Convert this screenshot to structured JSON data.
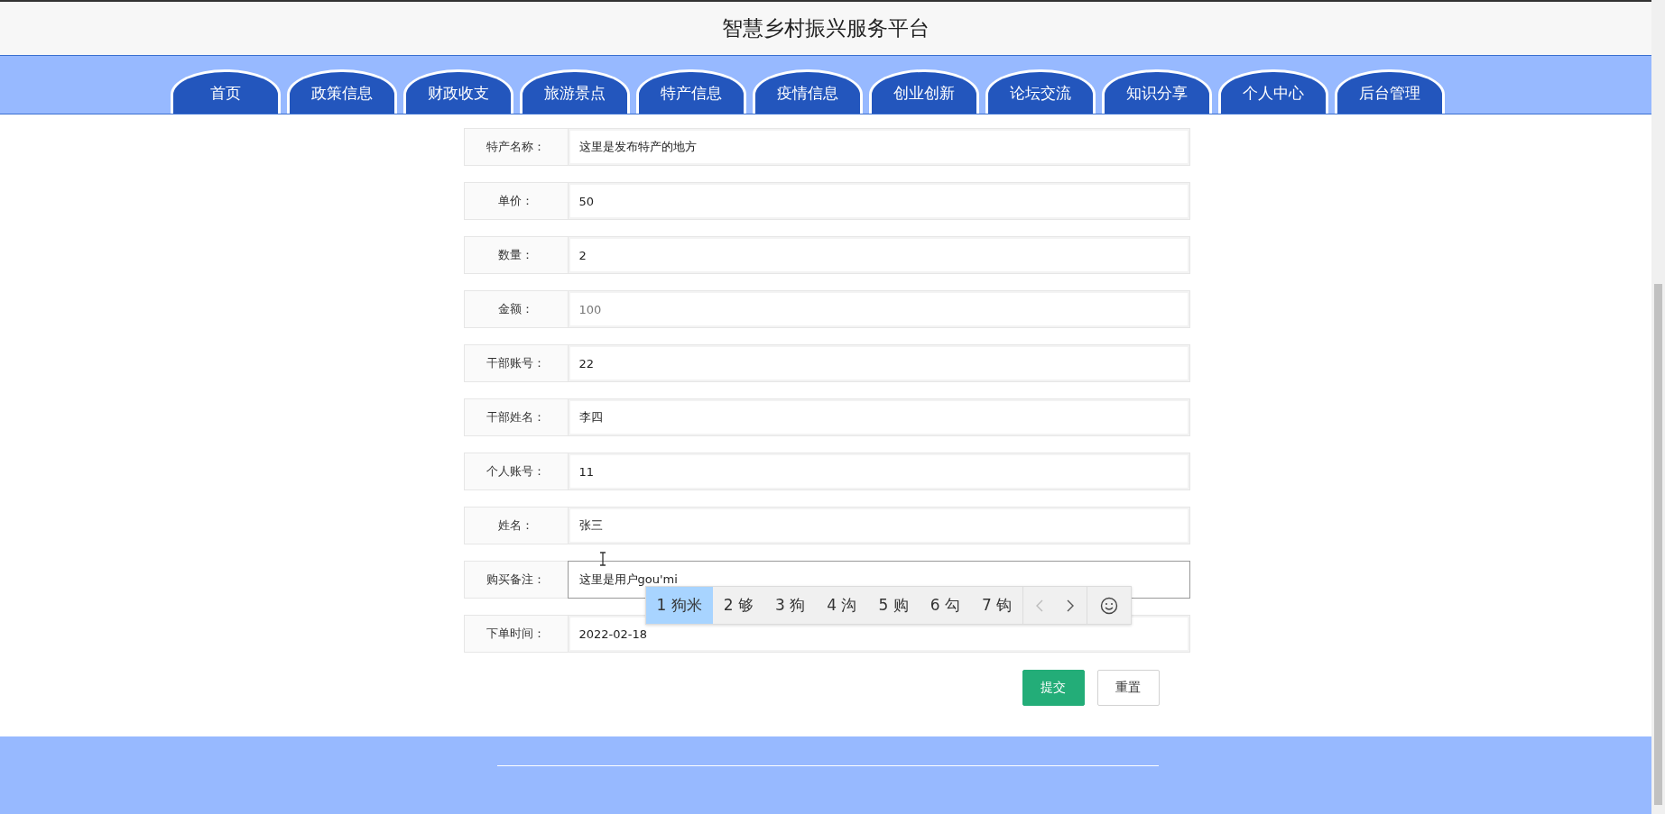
{
  "header": {
    "title": "智慧乡村振兴服务平台"
  },
  "nav": [
    {
      "label": "首页"
    },
    {
      "label": "政策信息"
    },
    {
      "label": "财政收支"
    },
    {
      "label": "旅游景点"
    },
    {
      "label": "特产信息"
    },
    {
      "label": "疫情信息"
    },
    {
      "label": "创业创新"
    },
    {
      "label": "论坛交流"
    },
    {
      "label": "知识分享"
    },
    {
      "label": "个人中心"
    },
    {
      "label": "后台管理"
    }
  ],
  "form": {
    "fields": [
      {
        "label": "特产名称：",
        "value": "这里是发布特产的地方",
        "readonly": false,
        "focused": false
      },
      {
        "label": "单价：",
        "value": "50",
        "readonly": false,
        "focused": false
      },
      {
        "label": "数量：",
        "value": "2",
        "readonly": false,
        "focused": false
      },
      {
        "label": "金额：",
        "value": "100",
        "readonly": true,
        "focused": false
      },
      {
        "label": "干部账号：",
        "value": "22",
        "readonly": false,
        "focused": false
      },
      {
        "label": "干部姓名：",
        "value": "李四",
        "readonly": false,
        "focused": false
      },
      {
        "label": "个人账号：",
        "value": "11",
        "readonly": false,
        "focused": false
      },
      {
        "label": "姓名：",
        "value": "张三",
        "readonly": false,
        "focused": false
      },
      {
        "label": "购买备注：",
        "value": "这里是用户gou'mi",
        "readonly": false,
        "focused": true
      },
      {
        "label": "下单时间：",
        "value": "2022-02-18",
        "readonly": false,
        "focused": false
      }
    ],
    "buttons": [
      {
        "label": "提交",
        "kind": "primary"
      },
      {
        "label": "重置",
        "kind": "default"
      }
    ]
  },
  "ime": {
    "candidates": [
      {
        "label": "1 狗米",
        "selected": true
      },
      {
        "label": "2 够",
        "selected": false
      },
      {
        "label": "3 狗",
        "selected": false
      },
      {
        "label": "4 沟",
        "selected": false
      },
      {
        "label": "5 购",
        "selected": false
      },
      {
        "label": "6 勾",
        "selected": false
      },
      {
        "label": "7 钩",
        "selected": false
      }
    ]
  }
}
